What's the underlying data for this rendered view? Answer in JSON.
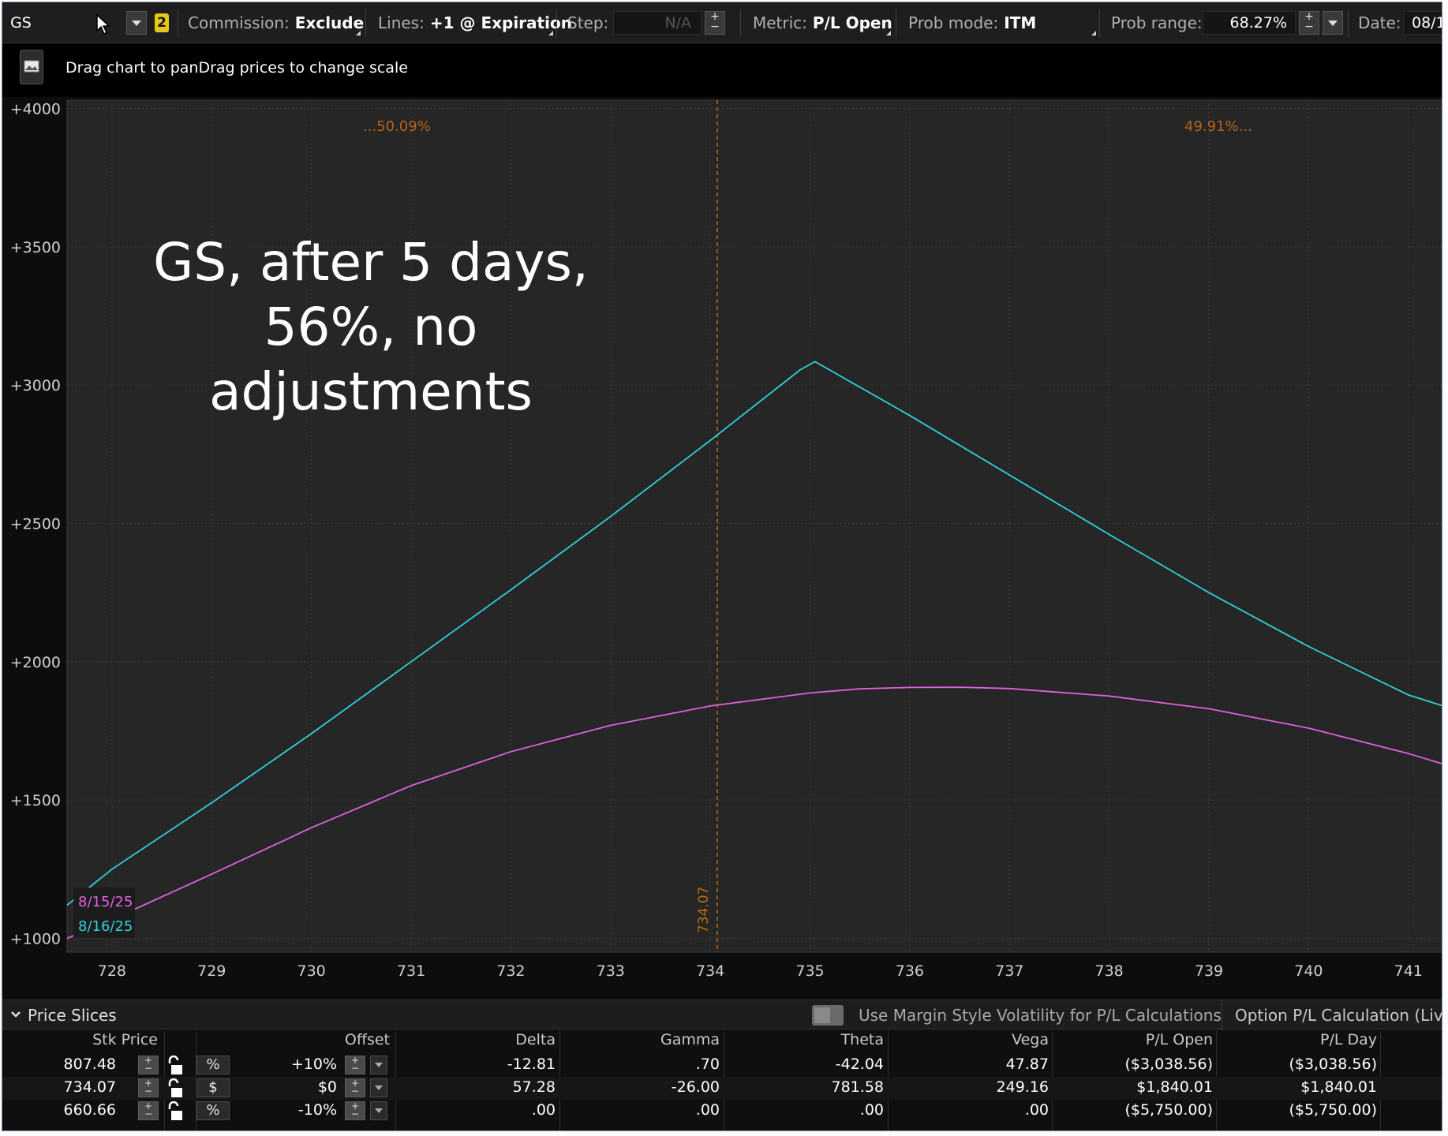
{
  "toolbar": {
    "symbol": "GS",
    "link_badge": "2",
    "commission_label": "Commission:",
    "commission_value": "Exclude",
    "lines_label": "Lines:",
    "lines_value": "+1 @ Expiration",
    "step_label": "Step:",
    "step_value": "N/A",
    "metric_label": "Metric:",
    "metric_value": "P/L Open",
    "prob_mode_label": "Prob mode:",
    "prob_mode_value": "ITM",
    "prob_range_label": "Prob range:",
    "prob_range_value": "68.27%",
    "date_label": "Date:",
    "date_value": "08/1"
  },
  "hint": {
    "text": "Drag chart to panDrag prices to change scale"
  },
  "overlay_text": [
    "GS, after 5 days,",
    "56%, no",
    "adjustments"
  ],
  "chart_data": {
    "type": "line",
    "xlim": [
      727.55,
      741.35
    ],
    "ylim": [
      950,
      4030
    ],
    "x_ticks": [
      728,
      729,
      730,
      731,
      732,
      733,
      734,
      735,
      736,
      737,
      738,
      739,
      740,
      741
    ],
    "y_ticks": [
      1000,
      1500,
      2000,
      2500,
      3000,
      3500,
      4000
    ],
    "y_tick_labels": [
      "+1000",
      "+1500",
      "+2000",
      "+2500",
      "+3000",
      "+3500",
      "+4000"
    ],
    "current_price": 734.07,
    "current_price_label": "734.07",
    "prob_left_label": "...50.09%",
    "prob_right_label": "49.91%...",
    "legend": [
      {
        "label": "8/15/25",
        "color": "#e060e0"
      },
      {
        "label": "8/16/25",
        "color": "#30d0d8"
      }
    ],
    "series": [
      {
        "name": "8/15/25",
        "color": "#e060e0",
        "x": [
          727.55,
          728,
          729,
          730,
          731,
          732,
          733,
          734,
          735,
          735.5,
          736,
          736.5,
          737,
          738,
          739,
          740,
          741,
          741.35
        ],
        "y": [
          1000,
          1068,
          1232,
          1400,
          1552,
          1675,
          1770,
          1840,
          1887,
          1902,
          1907,
          1908,
          1903,
          1876,
          1830,
          1760,
          1668,
          1630
        ]
      },
      {
        "name": "8/16/25",
        "color": "#30d0d8",
        "x": [
          727.55,
          728,
          729,
          730,
          731,
          732,
          733,
          734,
          734.9,
          735.05,
          736,
          737,
          738,
          739,
          740,
          741,
          741.35
        ],
        "y": [
          1120,
          1250,
          1490,
          1740,
          2000,
          2260,
          2525,
          2800,
          3055,
          3085,
          2890,
          2675,
          2460,
          2250,
          2055,
          1880,
          1840
        ]
      }
    ]
  },
  "slices": {
    "title": "Price Slices",
    "margin_toggle_label": "Use Margin Style Volatility for P/L Calculations",
    "calc_label": "Option P/L Calculation (Live P",
    "headers": {
      "stk_price": "Stk Price",
      "offset": "Offset",
      "delta": "Delta",
      "gamma": "Gamma",
      "theta": "Theta",
      "vega": "Vega",
      "pl_open": "P/L Open",
      "pl_day": "P/L Day"
    },
    "rows": [
      {
        "stk_price": "807.48",
        "unit": "%",
        "offset": "+10%",
        "delta": "-12.81",
        "gamma": ".70",
        "theta": "-42.04",
        "vega": "47.87",
        "pl_open": "($3,038.56)",
        "pl_day": "($3,038.56)"
      },
      {
        "stk_price": "734.07",
        "unit": "$",
        "offset": "$0",
        "delta": "57.28",
        "gamma": "-26.00",
        "theta": "781.58",
        "vega": "249.16",
        "pl_open": "$1,840.01",
        "pl_day": "$1,840.01"
      },
      {
        "stk_price": "660.66",
        "unit": "%",
        "offset": "-10%",
        "delta": ".00",
        "gamma": ".00",
        "theta": ".00",
        "vega": ".00",
        "pl_open": "($5,750.00)",
        "pl_day": "($5,750.00)"
      }
    ]
  }
}
